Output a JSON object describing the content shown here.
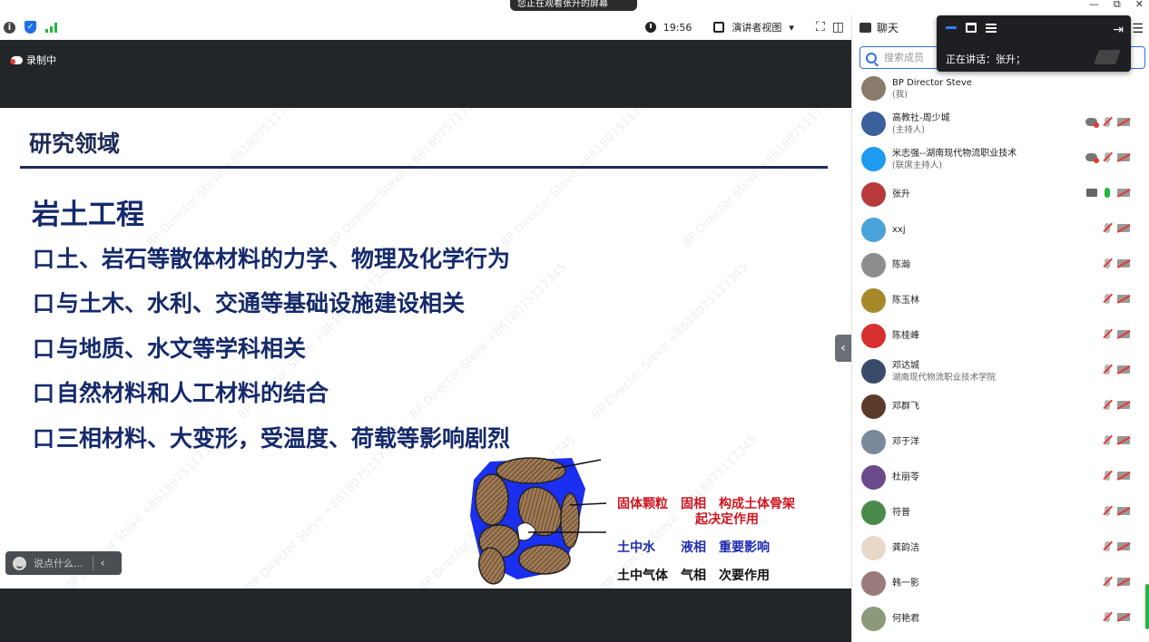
{
  "banner": {
    "text": "您正在观看张升的屏幕"
  },
  "window_controls": {
    "minimize": "—",
    "restore": "⧉",
    "close": "✕"
  },
  "toolbar": {
    "time": "19:56",
    "view_mode": "演讲者视图",
    "view_caret": "▾",
    "fullscreen_glyph": "⛶",
    "split_glyph": "◫"
  },
  "stage": {
    "recording_label": "录制中",
    "comment_placeholder": "说点什么...",
    "collapse_glyph": "‹"
  },
  "slide": {
    "title": "研究领域",
    "heading": "岩土工程",
    "bullet_marker": "口",
    "bullets": [
      "土、岩石等散体材料的力学、物理及化学行为",
      "与土木、水利、交通等基础设施建设相关",
      "与地质、水文等学科相关",
      "自然材料和人工材料的结合",
      "三相材料、大变形，受温度、荷载等影响剧烈"
    ],
    "diagram_labels": {
      "solid_line1": "固体颗粒　固相　构成土体骨架",
      "solid_line2": "起决定作用",
      "water": "土中水　　液相　重要影响",
      "gas": "土中气体　气相　次要作用"
    },
    "watermark": "BP Director Steve +8618075117345"
  },
  "chat": {
    "header_label": "聊天",
    "menu_glyph": "☰",
    "search_placeholder": "搜索成员",
    "speaking_label": "正在讲话：张升；",
    "members": [
      {
        "name": "BP Director Steve",
        "sub": "(我)",
        "avatar_color": "#8a7a6a",
        "cloud": false,
        "screen": false,
        "mic": "none",
        "cam": false
      },
      {
        "name": "高教社-周少城",
        "sub": "(主持人)",
        "avatar_color": "#3a5f9a",
        "cloud": true,
        "screen": false,
        "mic": "off",
        "cam": true
      },
      {
        "name": "米志强--湖南现代物流职业技术",
        "sub": "(联席主持人)",
        "avatar_color": "#1e9af0",
        "cloud": true,
        "screen": false,
        "mic": "off",
        "cam": true
      },
      {
        "name": "张升",
        "sub": "",
        "avatar_color": "#b83a3a",
        "cloud": false,
        "screen": true,
        "mic": "on",
        "cam": true
      },
      {
        "name": "xxj",
        "sub": "",
        "avatar_color": "#4aa3d8",
        "cloud": false,
        "screen": false,
        "mic": "off",
        "cam": true
      },
      {
        "name": "陈瀚",
        "sub": "",
        "avatar_color": "#8d8d8d",
        "cloud": false,
        "screen": false,
        "mic": "off",
        "cam": true
      },
      {
        "name": "陈玉林",
        "sub": "",
        "avatar_color": "#a8892a",
        "cloud": false,
        "screen": false,
        "mic": "off",
        "cam": true
      },
      {
        "name": "陈桂峰",
        "sub": "",
        "avatar_color": "#d83030",
        "cloud": false,
        "screen": false,
        "mic": "off",
        "cam": true
      },
      {
        "name": "邓达城",
        "sub": "湖南现代物流职业技术学院",
        "avatar_color": "#3a4a6a",
        "cloud": false,
        "screen": false,
        "mic": "off",
        "cam": true
      },
      {
        "name": "邓群飞",
        "sub": "",
        "avatar_color": "#5a3a2a",
        "cloud": false,
        "screen": false,
        "mic": "off",
        "cam": true
      },
      {
        "name": "邓于洋",
        "sub": "",
        "avatar_color": "#7a8a9a",
        "cloud": false,
        "screen": false,
        "mic": "off",
        "cam": true
      },
      {
        "name": "杜丽苓",
        "sub": "",
        "avatar_color": "#6a4a8a",
        "cloud": false,
        "screen": false,
        "mic": "off",
        "cam": true
      },
      {
        "name": "符普",
        "sub": "",
        "avatar_color": "#4a8a4a",
        "cloud": false,
        "screen": false,
        "mic": "off",
        "cam": true
      },
      {
        "name": "龚韵洁",
        "sub": "",
        "avatar_color": "#e8d8c8",
        "cloud": false,
        "screen": false,
        "mic": "off",
        "cam": true
      },
      {
        "name": "韩一影",
        "sub": "",
        "avatar_color": "#9a7a7a",
        "cloud": false,
        "screen": false,
        "mic": "off",
        "cam": true
      },
      {
        "name": "何艳君",
        "sub": "",
        "avatar_color": "#8a9a7a",
        "cloud": false,
        "screen": false,
        "mic": "off",
        "cam": true
      }
    ]
  },
  "colors": {
    "accent": "#2d6fe6",
    "slide_text": "#152a6b",
    "label_red": "#d0141e",
    "label_blue": "#1e2bb0",
    "status_green": "#27b43e",
    "stage_bg": "#232629"
  }
}
